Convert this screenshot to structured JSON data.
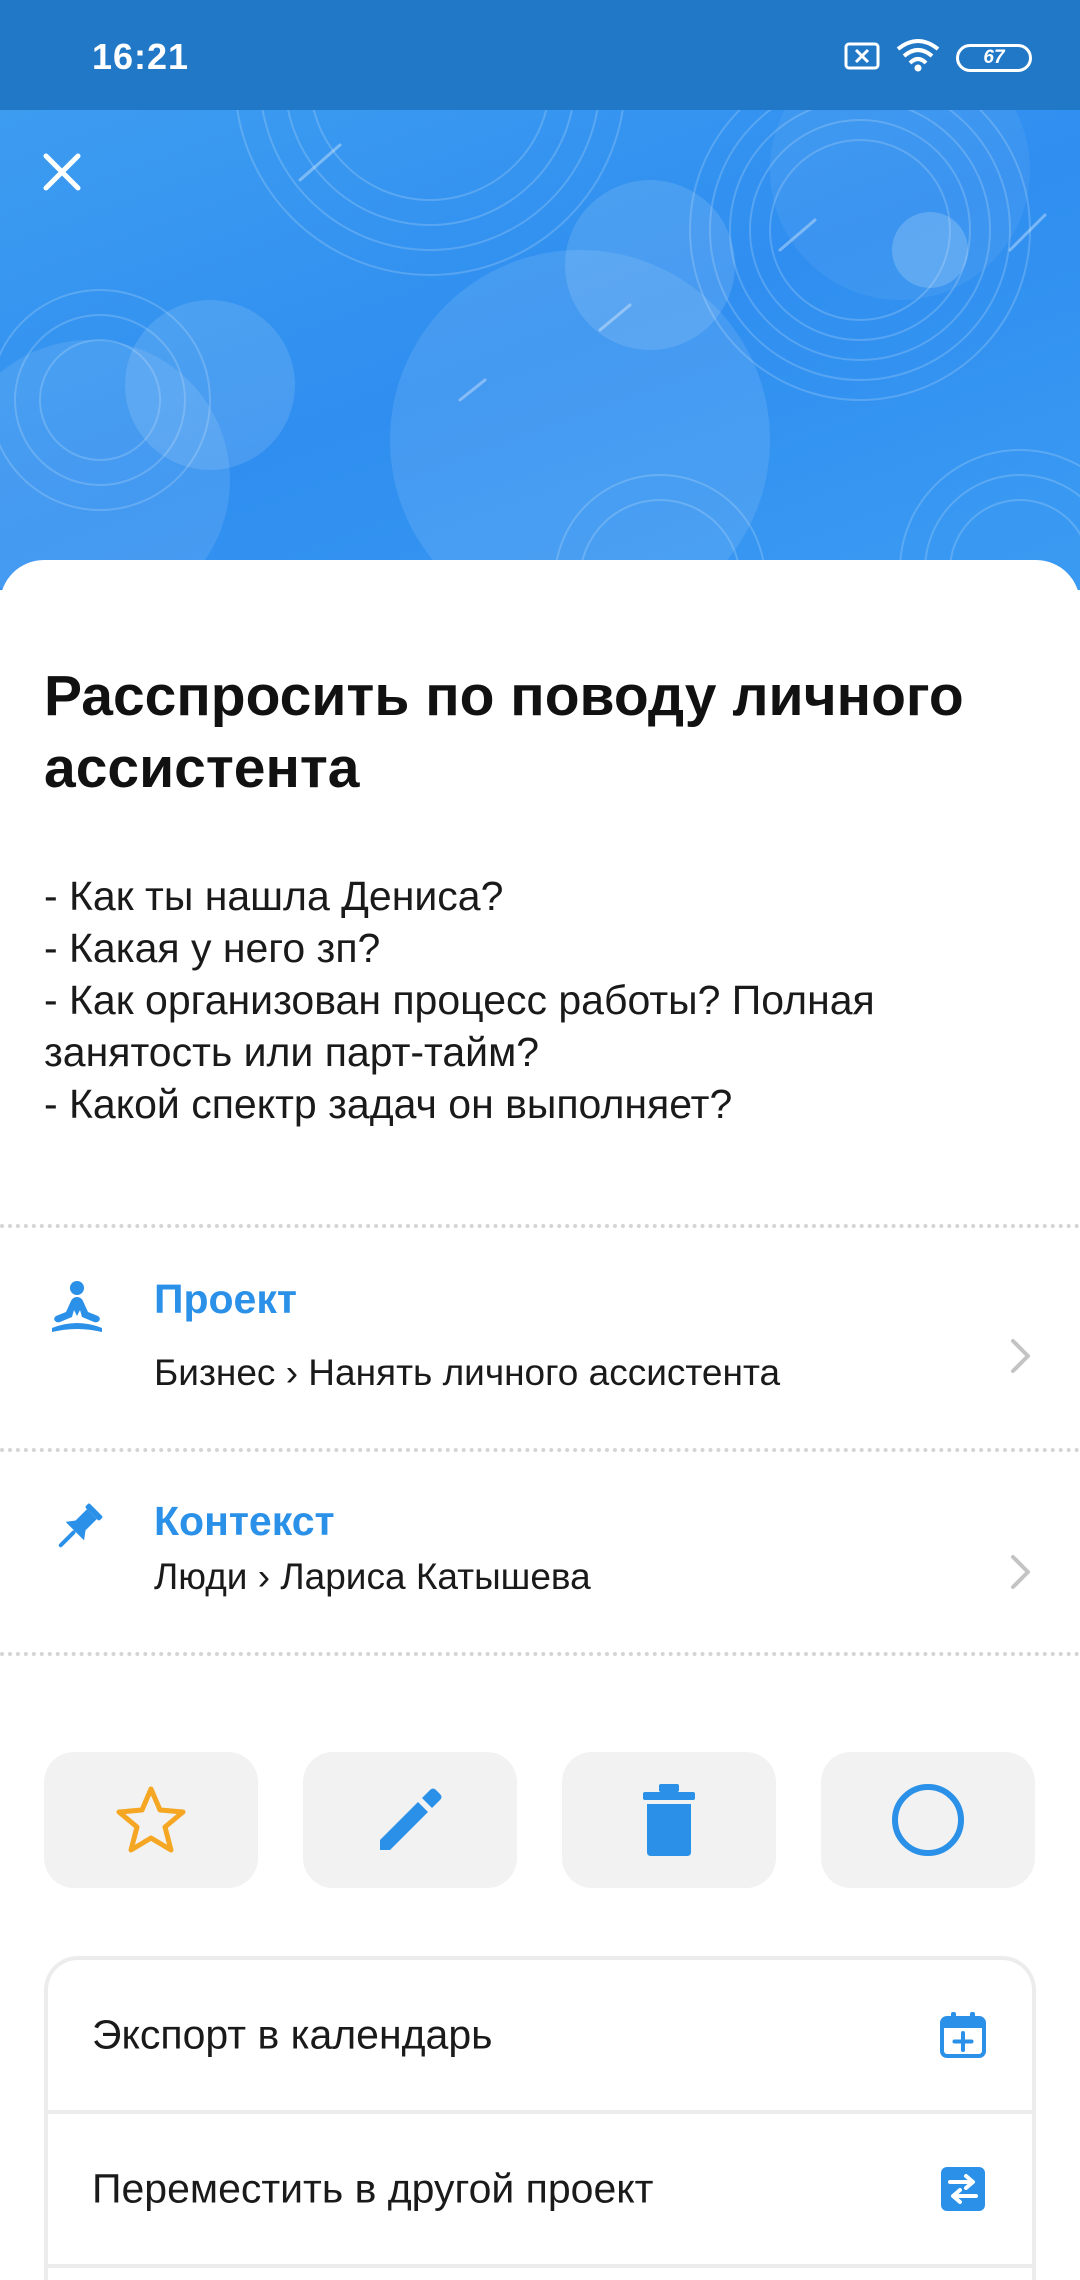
{
  "status_bar": {
    "time": "16:21",
    "battery": "67",
    "icons": [
      "sim-off-icon",
      "wifi-icon",
      "battery-icon"
    ]
  },
  "header": {
    "close_icon": "close-icon"
  },
  "task": {
    "title": "Расспросить по поводу личного ассистента",
    "notes": [
      "- Как ты нашла Дениса?",
      "- Какая у него зп?",
      "- Как организован процесс работы? Полная",
      "занятость или парт-тайм?",
      "- Какой спектр задач он выполняет?"
    ]
  },
  "project": {
    "label": "Проект",
    "value": "Бизнес › Нанять личного ассистента",
    "icon": "meditation-icon"
  },
  "context": {
    "label": "Контекст",
    "value": "Люди › Лариса Катышева",
    "icon": "pin-icon"
  },
  "actions": [
    {
      "name": "favorite",
      "icon": "star-icon"
    },
    {
      "name": "edit",
      "icon": "pencil-icon"
    },
    {
      "name": "delete",
      "icon": "trash-icon"
    },
    {
      "name": "complete",
      "icon": "circle-icon"
    }
  ],
  "menu": {
    "items": [
      {
        "label": "Экспорт в календарь",
        "icon": "calendar-add-icon"
      },
      {
        "label": "Переместить в другой проект",
        "icon": "swap-icon"
      }
    ]
  },
  "colors": {
    "accent": "#2a90e8",
    "status_bar": "#2178c7",
    "star": "#f5a623"
  }
}
